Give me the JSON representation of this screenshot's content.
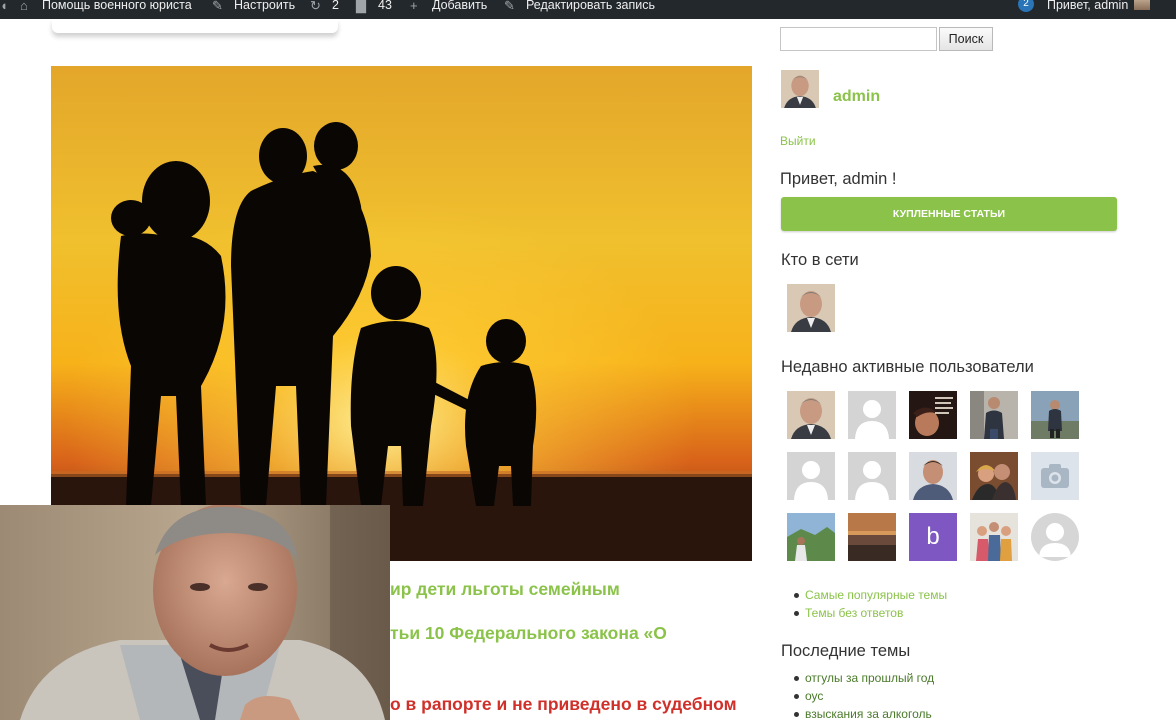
{
  "admin_bar": {
    "help_label": "Помощь военного юриста",
    "customize_label": "Настроить",
    "updates_count": "2",
    "comments_count": "43",
    "add_label": "Добавить",
    "edit_label": "Редактировать запись",
    "notif_count": "2",
    "greeting": "Привет, admin"
  },
  "post_list": {
    "titles": [
      "ир дети льготы семейным",
      "тьи 10 Федерального закона «О",
      "о в рапорте и не приведено в судебном"
    ]
  },
  "sidebar": {
    "search": {
      "placeholder": "",
      "button_label": "Поиск"
    },
    "profile": {
      "name": "admin",
      "logout_label": "Выйти"
    },
    "greeting": "Привет, admin !",
    "purchased_button_label": "КУПЛЕННЫЕ СТАТЬИ",
    "online_title": "Кто в сети",
    "recent_title": "Недавно активные пользователи",
    "forum_links": [
      "Самые популярные темы",
      "Темы без ответов"
    ],
    "latest_topics_title": "Последние темы",
    "latest_topics": [
      "отгулы за прошлый год",
      "оус",
      "взыскания за алкоголь"
    ],
    "recent_letter_avatar": "b"
  },
  "colors": {
    "accent": "#8bc34a",
    "admin_bar_bg": "#23282d",
    "title_red": "#d0302a",
    "letter_avatar_bg": "#7e57c2"
  }
}
